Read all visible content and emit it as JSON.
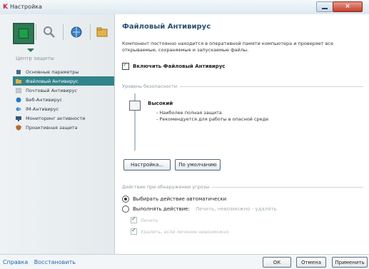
{
  "window": {
    "title": "Настройка",
    "close_glyph": "×"
  },
  "sidebar": {
    "section_title": "Центр защиты",
    "items": [
      {
        "label": "Основные параметры",
        "icon": "gear-icon",
        "color": "#4a6b8a"
      },
      {
        "label": "Файловый Антивирус",
        "icon": "folder-shield-icon",
        "color": "#d9a93c",
        "active": true
      },
      {
        "label": "Почтовый Антивирус",
        "icon": "mail-icon",
        "color": "#9aa5ad"
      },
      {
        "label": "Веб-Антивирус",
        "icon": "globe-icon",
        "color": "#2d77c2"
      },
      {
        "label": "IM-Антивирус",
        "icon": "chat-icon",
        "color": "#3b85c8"
      },
      {
        "label": "Мониторинг активности",
        "icon": "monitor-icon",
        "color": "#3a5577"
      },
      {
        "label": "Проактивная защита",
        "icon": "shield-icon",
        "color": "#b86a2d"
      }
    ]
  },
  "main": {
    "title": "Файловый Антивирус",
    "description": "Компонент постоянно находится в оперативной памяти компьютера и проверяет все открываемые, сохраняемые и запускаемые файлы.",
    "enable_label": "Включить Файловый Антивирус",
    "security_group": "Уровень безопасности",
    "level_name": "Высокий",
    "level_desc_1": "- Наиболее полная защита",
    "level_desc_2": "- Рекомендуется для работы в опасной среде",
    "settings_button": "Настройка...",
    "default_button": "По умолчанию",
    "action_group": "Действие при обнаружении угрозы",
    "radio_auto": "Выбирать действие автоматически",
    "radio_action": "Выполнять действие:",
    "action_value": "Лечить, невозможно - удалять",
    "sub_treat": "Лечить",
    "sub_delete": "Удалить, если лечение невозможно"
  },
  "footer": {
    "help": "Справка",
    "restore": "Восстановить",
    "ok": "ОК",
    "cancel": "Отмена",
    "apply": "Применить"
  }
}
